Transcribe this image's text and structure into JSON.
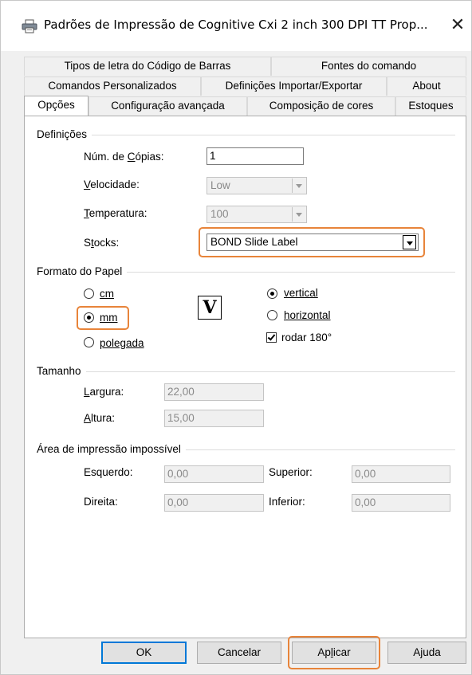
{
  "window": {
    "title": "Padrões de Impressão de Cognitive Cxi 2 inch 300 DPI TT Prop...",
    "close": "✕"
  },
  "tabs": {
    "row1": [
      "Tipos de letra do Código de Barras",
      "Fontes do comando"
    ],
    "row2": [
      "Comandos Personalizados",
      "Definições Importar/Exportar",
      "About"
    ],
    "row3": [
      "Opções",
      "Configuração avançada",
      "Composição de cores",
      "Estoques"
    ]
  },
  "settings": {
    "group": "Definições",
    "copies_label": "Núm. de Cópias:",
    "copies_value": "1",
    "speed_label": "Velocidade:",
    "speed_value": "Low",
    "temp_label": "Temperatura:",
    "temp_value": "100",
    "stocks_label": "Stocks:",
    "stocks_value": "BOND Slide Label"
  },
  "paper_format": {
    "group": "Formato do Papel",
    "units": [
      "cm",
      "mm",
      "polegada"
    ],
    "selected_unit": "mm",
    "orientation_icon": "V",
    "orientation": [
      "vertical",
      "horizontal"
    ],
    "selected_orientation": "vertical",
    "rotate_label": "rodar 180°",
    "rotate_checked": true
  },
  "size": {
    "group": "Tamanho",
    "width_label": "Largura:",
    "width_value": "22,00",
    "height_label": "Altura:",
    "height_value": "15,00"
  },
  "unprintable": {
    "group": "Área de impressão impossível",
    "left_label": "Esquerdo:",
    "left_value": "0,00",
    "top_label": "Superior:",
    "top_value": "0,00",
    "right_label": "Direita:",
    "right_value": "0,00",
    "bottom_label": "Inferior:",
    "bottom_value": "0,00"
  },
  "buttons": {
    "ok": "OK",
    "cancel": "Cancelar",
    "apply": "Aplicar",
    "help": "Ajuda"
  },
  "colors": {
    "highlight": "#e8843a",
    "default_button_border": "#0078d7"
  }
}
